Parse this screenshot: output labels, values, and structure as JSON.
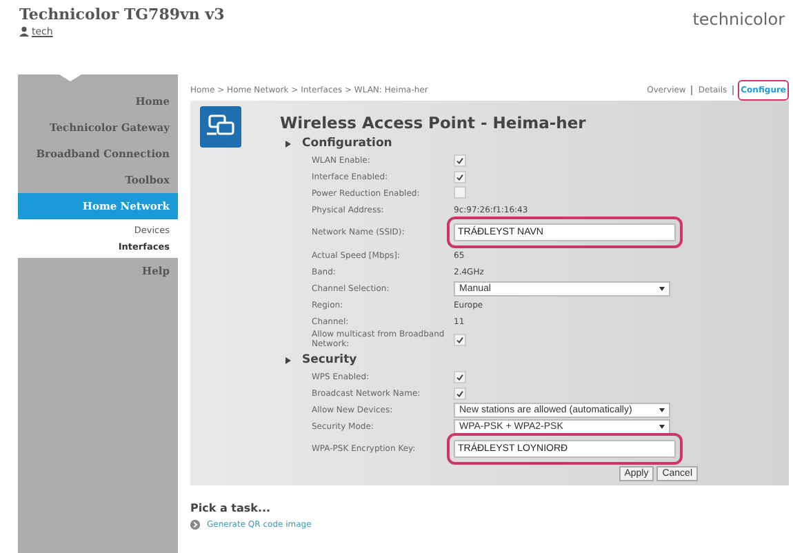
{
  "header": {
    "title": "Technicolor TG789vn v3",
    "user": "tech",
    "brand": "technicolor"
  },
  "sidebar": {
    "items": [
      {
        "label": "Home",
        "selected": false
      },
      {
        "label": "Technicolor Gateway",
        "selected": false
      },
      {
        "label": "Broadband Connection",
        "selected": false
      },
      {
        "label": "Toolbox",
        "selected": false
      },
      {
        "label": "Home Network",
        "selected": true,
        "children": [
          {
            "label": "Devices",
            "selected": false
          },
          {
            "label": "Interfaces",
            "selected": true
          }
        ]
      },
      {
        "label": "Help",
        "selected": false
      }
    ]
  },
  "breadcrumb": "Home > Home Network > Interfaces > WLAN: Heima-her",
  "view_links": [
    {
      "label": "Overview",
      "selected": false,
      "highlighted": false
    },
    {
      "label": "Details",
      "selected": false,
      "highlighted": false
    },
    {
      "label": "Configure",
      "selected": true,
      "highlighted": true
    }
  ],
  "panel": {
    "title": "Wireless Access Point - Heima-her",
    "sections": [
      {
        "title": "Configuration",
        "rows": [
          {
            "kind": "checkbox",
            "label": "WLAN Enable:",
            "checked": true
          },
          {
            "kind": "checkbox",
            "label": "Interface Enabled:",
            "checked": true
          },
          {
            "kind": "checkbox",
            "label": "Power Reduction Enabled:",
            "checked": false
          },
          {
            "kind": "text",
            "label": "Physical Address:",
            "value": "9c:97:26:f1:16:43"
          },
          {
            "kind": "input",
            "label": "Network Name (SSID):",
            "value": "TRÁÐLEYST NAVN",
            "highlighted": true
          },
          {
            "kind": "text",
            "label": "Actual Speed [Mbps]:",
            "value": "65"
          },
          {
            "kind": "text",
            "label": "Band:",
            "value": "2.4GHz"
          },
          {
            "kind": "select",
            "label": "Channel Selection:",
            "value": "Manual"
          },
          {
            "kind": "text",
            "label": "Region:",
            "value": "Europe"
          },
          {
            "kind": "text",
            "label": "Channel:",
            "value": "11"
          },
          {
            "kind": "checkbox",
            "label": "Allow multicast from Broadband Network:",
            "checked": true
          }
        ]
      },
      {
        "title": "Security",
        "rows": [
          {
            "kind": "checkbox",
            "label": "WPS Enabled:",
            "checked": true
          },
          {
            "kind": "checkbox",
            "label": "Broadcast Network Name:",
            "checked": true
          },
          {
            "kind": "select",
            "label": "Allow New Devices:",
            "value": "New stations are allowed (automatically)"
          },
          {
            "kind": "select",
            "label": "Security Mode:",
            "value": "WPA-PSK + WPA2-PSK"
          },
          {
            "kind": "input",
            "label": "WPA-PSK Encryption Key:",
            "value": "TRÁÐLEYST LOYNIORÐ",
            "highlighted": true
          }
        ]
      }
    ],
    "buttons": [
      "Apply",
      "Cancel"
    ]
  },
  "tasks": {
    "title": "Pick a task...",
    "items": [
      "Generate QR code image"
    ]
  }
}
